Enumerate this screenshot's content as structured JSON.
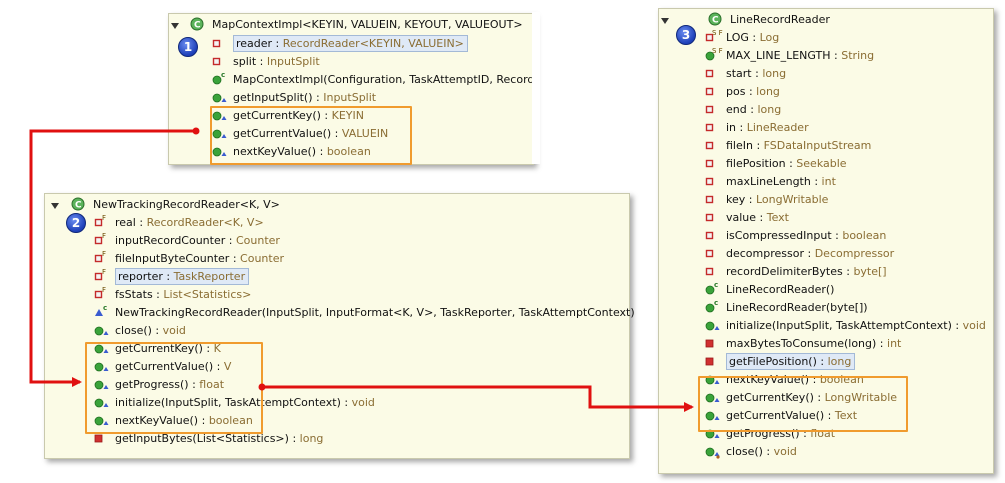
{
  "panels": {
    "p1": {
      "badge": "1",
      "title": "MapContextImpl<KEYIN, VALUEIN, KEYOUT, VALUEOUT>",
      "rows": [
        {
          "icon": "field-private",
          "name": "reader",
          "type": "RecordReader<KEYIN, VALUEIN>",
          "highlight": true
        },
        {
          "icon": "field-private",
          "name": "split",
          "type": "InputSplit"
        },
        {
          "icon": "constructor",
          "name": "MapContextImpl(Configuration, TaskAttemptID, Record",
          "type": ""
        },
        {
          "icon": "method-public-override",
          "name": "getInputSplit()",
          "type": "InputSplit"
        },
        {
          "icon": "method-public-override",
          "name": "getCurrentKey()",
          "type": "KEYIN"
        },
        {
          "icon": "method-public-override",
          "name": "getCurrentValue()",
          "type": "VALUEIN"
        },
        {
          "icon": "method-public-override",
          "name": "nextKeyValue()",
          "type": "boolean"
        }
      ]
    },
    "p2": {
      "badge": "2",
      "title": "NewTrackingRecordReader<K, V>",
      "rows": [
        {
          "icon": "field-private-final",
          "name": "real",
          "type": "RecordReader<K, V>"
        },
        {
          "icon": "field-private-final",
          "name": "inputRecordCounter",
          "type": "Counter"
        },
        {
          "icon": "field-private-final",
          "name": "fileInputByteCounter",
          "type": "Counter"
        },
        {
          "icon": "field-private-final",
          "name": "reporter",
          "type": "TaskReporter",
          "highlight": true
        },
        {
          "icon": "field-private-final",
          "name": "fsStats",
          "type": "List<Statistics>"
        },
        {
          "icon": "constructor-package",
          "name": "NewTrackingRecordReader(InputSplit, InputFormat<K, V>, TaskReporter, TaskAttemptContext)",
          "type": ""
        },
        {
          "icon": "method-public-override",
          "name": "close()",
          "type": "void"
        },
        {
          "icon": "method-public-override",
          "name": "getCurrentKey()",
          "type": "K"
        },
        {
          "icon": "method-public-override",
          "name": "getCurrentValue()",
          "type": "V"
        },
        {
          "icon": "method-public-override",
          "name": "getProgress()",
          "type": "float"
        },
        {
          "icon": "method-public-override",
          "name": "initialize(InputSplit, TaskAttemptContext)",
          "type": "void"
        },
        {
          "icon": "method-public-override",
          "name": "nextKeyValue()",
          "type": "boolean"
        },
        {
          "icon": "method-private",
          "name": "getInputBytes(List<Statistics>)",
          "type": "long"
        }
      ]
    },
    "p3": {
      "badge": "3",
      "title": "LineRecordReader",
      "rows": [
        {
          "icon": "field-static-final",
          "name": "LOG",
          "type": "Log"
        },
        {
          "icon": "field-static-final-public",
          "name": "MAX_LINE_LENGTH",
          "type": "String"
        },
        {
          "icon": "field-private",
          "name": "start",
          "type": "long"
        },
        {
          "icon": "field-private",
          "name": "pos",
          "type": "long"
        },
        {
          "icon": "field-private",
          "name": "end",
          "type": "long"
        },
        {
          "icon": "field-private",
          "name": "in",
          "type": "LineReader"
        },
        {
          "icon": "field-private",
          "name": "fileIn",
          "type": "FSDataInputStream"
        },
        {
          "icon": "field-private",
          "name": "filePosition",
          "type": "Seekable"
        },
        {
          "icon": "field-private",
          "name": "maxLineLength",
          "type": "int"
        },
        {
          "icon": "field-private",
          "name": "key",
          "type": "LongWritable"
        },
        {
          "icon": "field-private",
          "name": "value",
          "type": "Text"
        },
        {
          "icon": "field-private",
          "name": "isCompressedInput",
          "type": "boolean"
        },
        {
          "icon": "field-private",
          "name": "decompressor",
          "type": "Decompressor"
        },
        {
          "icon": "field-private",
          "name": "recordDelimiterBytes",
          "type": "byte[]"
        },
        {
          "icon": "constructor",
          "name": "LineRecordReader()",
          "type": ""
        },
        {
          "icon": "constructor",
          "name": "LineRecordReader(byte[])",
          "type": ""
        },
        {
          "icon": "method-public-override",
          "name": "initialize(InputSplit, TaskAttemptContext)",
          "type": "void"
        },
        {
          "icon": "method-private",
          "name": "maxBytesToConsume(long)",
          "type": "int"
        },
        {
          "icon": "method-private",
          "name": "getFilePosition()",
          "type": "long",
          "highlight": true
        },
        {
          "icon": "method-public-override",
          "name": "nextKeyValue()",
          "type": "boolean"
        },
        {
          "icon": "method-public-override",
          "name": "getCurrentKey()",
          "type": "LongWritable"
        },
        {
          "icon": "method-public-override",
          "name": "getCurrentValue()",
          "type": "Text"
        },
        {
          "icon": "method-public-override",
          "name": "getProgress()",
          "type": "float"
        },
        {
          "icon": "method-public-override-sync",
          "name": "close()",
          "type": "void"
        }
      ]
    }
  },
  "colors": {
    "panel_bg": "#fbfbe6",
    "arrow": "#e01010",
    "highlight_box": "#f09b2e",
    "type_text": "#8a6d33",
    "badge": "#1d3fb8"
  }
}
